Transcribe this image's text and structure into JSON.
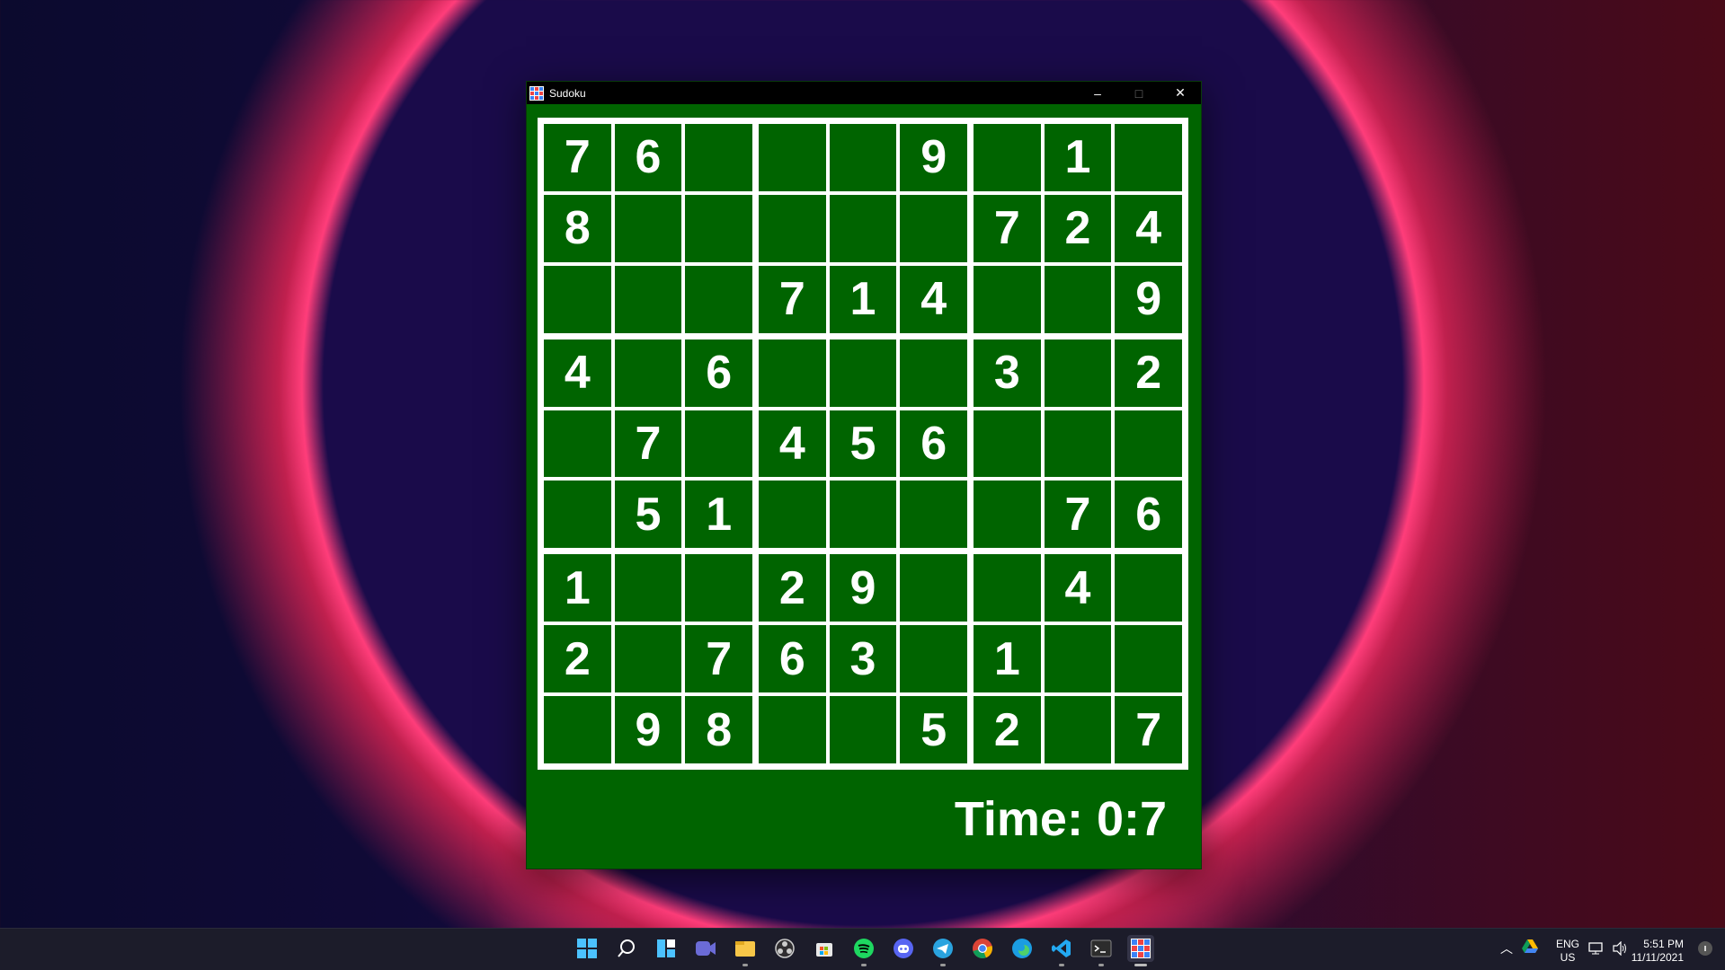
{
  "window": {
    "title": "Sudoku",
    "minimize_glyph": "–",
    "maximize_glyph": "□",
    "close_glyph": "✕"
  },
  "board": [
    [
      "7",
      "6",
      "",
      "",
      "",
      "9",
      "",
      "1",
      ""
    ],
    [
      "8",
      "",
      "",
      "",
      "",
      "",
      "7",
      "2",
      "4"
    ],
    [
      "",
      "",
      "",
      "7",
      "1",
      "4",
      "",
      "",
      "9"
    ],
    [
      "4",
      "",
      "6",
      "",
      "",
      "",
      "3",
      "",
      "2"
    ],
    [
      "",
      "7",
      "",
      "4",
      "5",
      "6",
      "",
      "",
      ""
    ],
    [
      "",
      "5",
      "1",
      "",
      "",
      "",
      "",
      "7",
      "6"
    ],
    [
      "1",
      "",
      "",
      "2",
      "9",
      "",
      "",
      "4",
      ""
    ],
    [
      "2",
      "",
      "7",
      "6",
      "3",
      "",
      "1",
      "",
      ""
    ],
    [
      "",
      "9",
      "8",
      "",
      "",
      "5",
      "2",
      "",
      "7"
    ]
  ],
  "timer": {
    "text": "Time: 0:7"
  },
  "colors": {
    "board_bg": "#006400",
    "lines": "#ffffff",
    "digits": "#ffffff"
  },
  "taskbar": {
    "icons": [
      "windows-start-icon",
      "search-icon",
      "widgets-icon",
      "chat-icon",
      "file-explorer-icon",
      "obs-icon",
      "store-icon",
      "spotify-icon",
      "discord-icon",
      "telegram-icon",
      "chrome-icon",
      "edge-icon",
      "vscode-icon",
      "terminal-icon",
      "sudoku-app-icon"
    ],
    "tray": {
      "lang_top": "ENG",
      "lang_bottom": "US",
      "time": "5:51 PM",
      "date": "11/11/2021"
    }
  }
}
